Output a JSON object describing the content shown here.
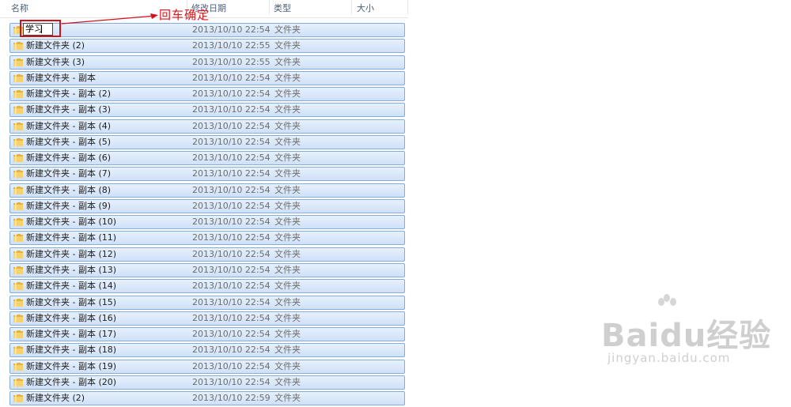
{
  "columns": {
    "name": "名称",
    "date": "修改日期",
    "type": "类型",
    "size": "大小"
  },
  "annotation": "回车确定",
  "rename_value": "学习",
  "rows": [
    {
      "name": "",
      "date": "2013/10/10 22:54",
      "type": "文件夹"
    },
    {
      "name": "新建文件夹  (2)",
      "date": "2013/10/10 22:55",
      "type": "文件夹"
    },
    {
      "name": "新建文件夹  (3)",
      "date": "2013/10/10 22:55",
      "type": "文件夹"
    },
    {
      "name": "新建文件夹 - 副本",
      "date": "2013/10/10 22:54",
      "type": "文件夹"
    },
    {
      "name": "新建文件夹 - 副本 (2)",
      "date": "2013/10/10 22:54",
      "type": "文件夹"
    },
    {
      "name": "新建文件夹 - 副本 (3)",
      "date": "2013/10/10 22:54",
      "type": "文件夹"
    },
    {
      "name": "新建文件夹 - 副本 (4)",
      "date": "2013/10/10 22:54",
      "type": "文件夹"
    },
    {
      "name": "新建文件夹 - 副本 (5)",
      "date": "2013/10/10 22:54",
      "type": "文件夹"
    },
    {
      "name": "新建文件夹 - 副本 (6)",
      "date": "2013/10/10 22:54",
      "type": "文件夹"
    },
    {
      "name": "新建文件夹 - 副本 (7)",
      "date": "2013/10/10 22:54",
      "type": "文件夹"
    },
    {
      "name": "新建文件夹 - 副本 (8)",
      "date": "2013/10/10 22:54",
      "type": "文件夹"
    },
    {
      "name": "新建文件夹 - 副本 (9)",
      "date": "2013/10/10 22:54",
      "type": "文件夹"
    },
    {
      "name": "新建文件夹 - 副本 (10)",
      "date": "2013/10/10 22:54",
      "type": "文件夹"
    },
    {
      "name": "新建文件夹 - 副本 (11)",
      "date": "2013/10/10 22:54",
      "type": "文件夹"
    },
    {
      "name": "新建文件夹 - 副本 (12)",
      "date": "2013/10/10 22:54",
      "type": "文件夹"
    },
    {
      "name": "新建文件夹 - 副本 (13)",
      "date": "2013/10/10 22:54",
      "type": "文件夹"
    },
    {
      "name": "新建文件夹 - 副本 (14)",
      "date": "2013/10/10 22:54",
      "type": "文件夹"
    },
    {
      "name": "新建文件夹 - 副本 (15)",
      "date": "2013/10/10 22:54",
      "type": "文件夹"
    },
    {
      "name": "新建文件夹 - 副本 (16)",
      "date": "2013/10/10 22:54",
      "type": "文件夹"
    },
    {
      "name": "新建文件夹 - 副本 (17)",
      "date": "2013/10/10 22:54",
      "type": "文件夹"
    },
    {
      "name": "新建文件夹 - 副本 (18)",
      "date": "2013/10/10 22:54",
      "type": "文件夹"
    },
    {
      "name": "新建文件夹 - 副本 (19)",
      "date": "2013/10/10 22:54",
      "type": "文件夹"
    },
    {
      "name": "新建文件夹 - 副本 (20)",
      "date": "2013/10/10 22:54",
      "type": "文件夹"
    },
    {
      "name": "新建文件夹 (2)",
      "date": "2013/10/10 22:59",
      "type": "文件夹"
    }
  ],
  "watermark": {
    "brand": "Baidu经验",
    "sub": "jingyan.baidu.com"
  },
  "colors": {
    "row_border": "#84acdd",
    "row_fill": "#d9e8fb",
    "annotation_red": "#e1141c",
    "folder_yellow": "#f1c24b"
  }
}
